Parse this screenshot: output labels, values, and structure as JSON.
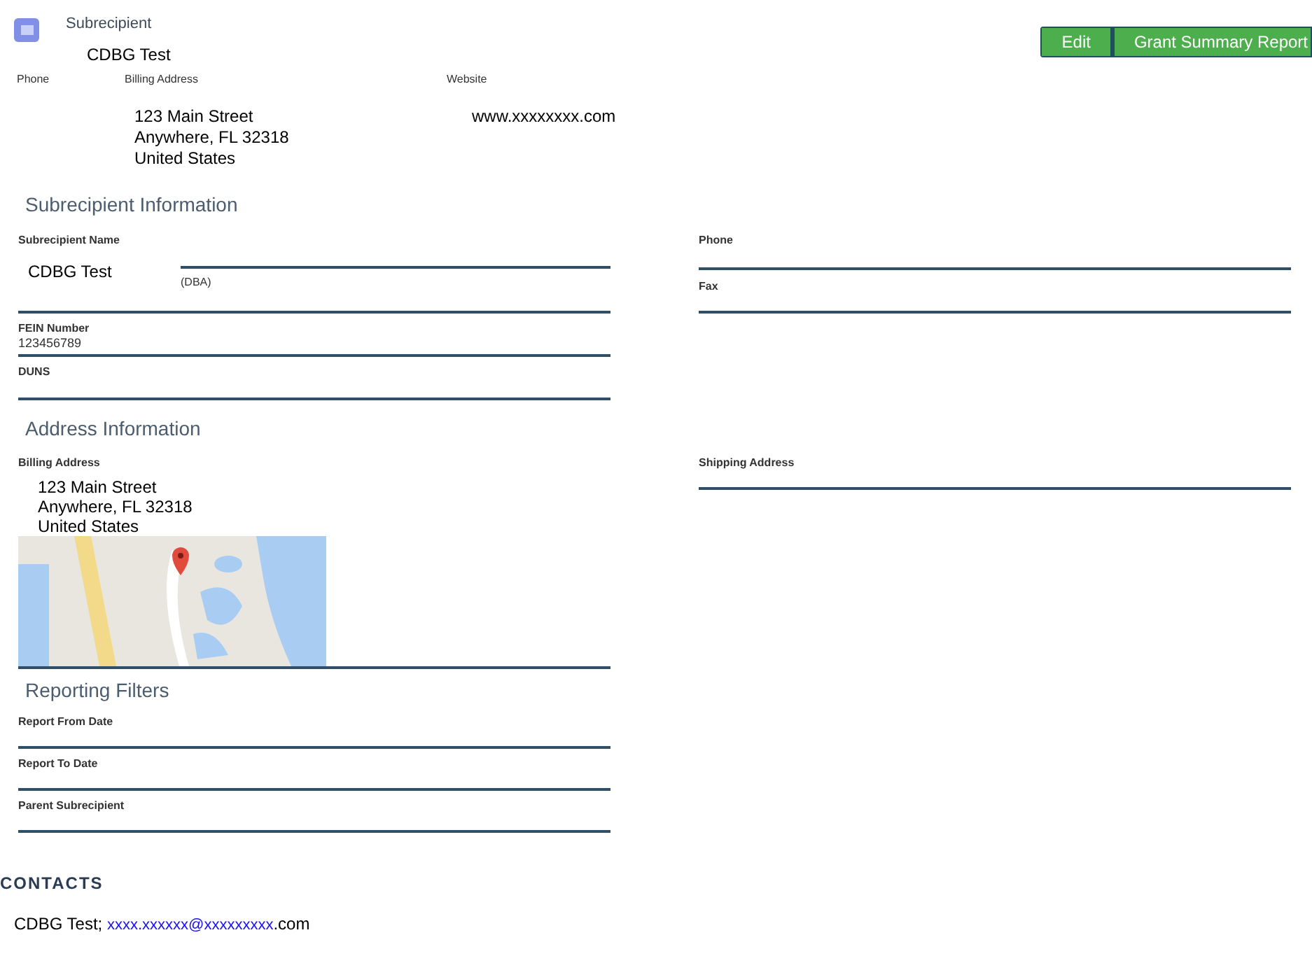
{
  "header": {
    "title": "Subrecipient",
    "name": "CDBG Test"
  },
  "buttons": [
    {
      "label": "Edit"
    },
    {
      "label": "Grant Summary Report"
    }
  ],
  "summary": [
    {
      "label": "Phone"
    },
    {
      "label": "Billing Address",
      "lines": [
        "123 Main Street",
        "Anywhere, FL 32318",
        "United States"
      ]
    },
    {
      "label": "Website",
      "lines": [
        "www.xxxxxxxx.com"
      ]
    }
  ],
  "subrecipient_information": {
    "heading": "Subrecipient Information",
    "left": [
      {
        "label": "Subrecipient Name",
        "value": "CDBG Test",
        "sublabel": "(DBA)"
      },
      {
        "label": "FEIN Number",
        "value": "123456789"
      },
      {
        "label": "DUNS"
      }
    ],
    "right": [
      {
        "label": "Phone"
      },
      {
        "label": "Fax"
      }
    ]
  },
  "address_information": {
    "heading": "Address Information",
    "billing": {
      "label": "Billing Address",
      "lines": [
        "123 Main Street",
        "Anywhere, FL 32318",
        "United States"
      ]
    },
    "shipping": {
      "label": "Shipping Address"
    }
  },
  "reporting_filters": {
    "heading": "Reporting Filters",
    "fields": [
      {
        "label": "Report From Date"
      },
      {
        "label": "Report To Date"
      },
      {
        "label": "Parent Subrecipient"
      }
    ]
  },
  "contacts": {
    "heading": "CONTACTS",
    "items": [
      {
        "name": "CDBG Test;",
        "email": "xxxx.xxxxxx@xxxxxxxxx",
        "email_suffix": ".com"
      }
    ]
  }
}
